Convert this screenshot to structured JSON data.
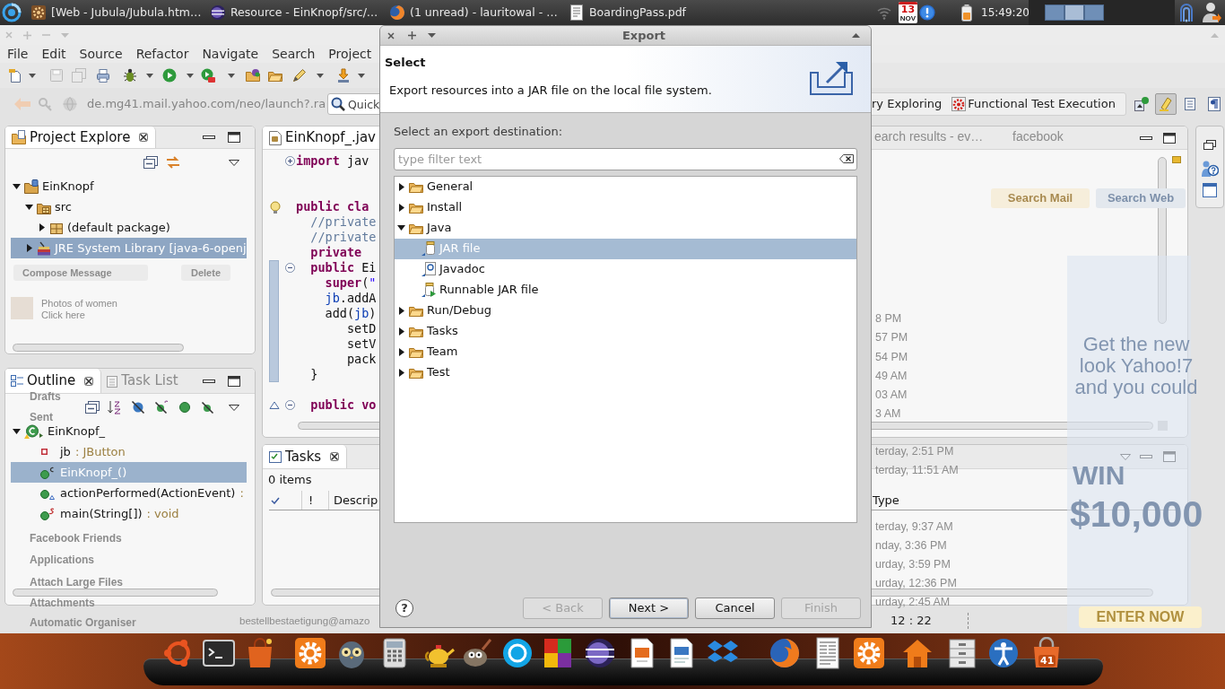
{
  "top_panel": {
    "taskbar": [
      {
        "label": "[Web - Jubula/Jubula.htm…"
      },
      {
        "label": "Resource - EinKnopf/src/…"
      },
      {
        "label": "(1 unread) - lauritowal - …"
      },
      {
        "label": "BoardingPass.pdf"
      }
    ],
    "calendar": {
      "day": "13",
      "month": "NOV"
    },
    "clock": "15:49:20",
    "workspaces": [
      {
        "selected": false
      },
      {
        "selected": true
      },
      {
        "selected": false
      }
    ]
  },
  "eclipse": {
    "menu": [
      "File",
      "Edit",
      "Source",
      "Refactor",
      "Navigate",
      "Search",
      "Project"
    ],
    "quick_access": {
      "placeholder": "Quick"
    },
    "perspectives": [
      {
        "label": "ry Exploring",
        "icon": false
      },
      {
        "label": "Functional Test Execution",
        "icon": true
      }
    ],
    "perspective_tools": [
      {
        "pressed": false
      },
      {
        "pressed": true
      },
      {
        "pressed": false
      },
      {
        "pressed": false
      }
    ],
    "project_explorer": {
      "title": "Project Explore",
      "tree": [
        {
          "kind": "project",
          "label": "EinKnopf",
          "expanded": true,
          "selected": false,
          "children": [
            {
              "kind": "source_folder",
              "label": "src",
              "expanded": true,
              "selected": false,
              "children": [
                {
                  "kind": "package",
                  "label": "(default package)",
                  "expanded": false,
                  "selected": false
                }
              ]
            },
            {
              "kind": "library",
              "label": "JRE System Library [java-6-openj",
              "expanded": false,
              "selected": true
            }
          ]
        }
      ]
    },
    "outline": {
      "tabs": [
        {
          "label": "Outline",
          "selected": true
        },
        {
          "label": "Task List",
          "selected": false
        }
      ],
      "tree": [
        {
          "kind": "class",
          "label": "EinKnopf_",
          "expanded": true,
          "selected": false,
          "children": [
            {
              "kind": "field",
              "label": "jb",
              "detail": ": JButton",
              "selected": false
            },
            {
              "kind": "constructor",
              "label": "EinKnopf_()",
              "selected": true
            },
            {
              "kind": "method",
              "label": "actionPerformed(ActionEvent)",
              "detail": ":",
              "selected": false
            },
            {
              "kind": "static_method",
              "label": "main(String[])",
              "detail": ": void",
              "selected": false
            }
          ]
        }
      ]
    },
    "editor": {
      "tab": "EinKnopf_.jav",
      "lines": [
        {
          "kind": "code",
          "collapsed": true,
          "tokens": [
            {
              "kind": "keyword",
              "text": "import"
            },
            {
              "kind": "plain",
              "text": " jav"
            }
          ]
        },
        {
          "kind": "blank"
        },
        {
          "kind": "blank"
        },
        {
          "kind": "code",
          "annotation": {
            "kind": "warning"
          },
          "tokens": [
            {
              "kind": "keyword",
              "text": "public cla"
            }
          ]
        },
        {
          "kind": "code",
          "tokens": [
            {
              "kind": "comment",
              "text": "  //private"
            }
          ]
        },
        {
          "kind": "code",
          "tokens": [
            {
              "kind": "comment",
              "text": "  //private"
            }
          ]
        },
        {
          "kind": "code",
          "tokens": [
            {
              "kind": "keyword",
              "text": "  private"
            }
          ]
        },
        {
          "kind": "highlighted_range",
          "lines": [
            {
              "kind": "code",
              "collapsed": false,
              "tokens": [
                {
                  "kind": "keyword",
                  "text": "  public"
                },
                {
                  "kind": "plain",
                  "text": " Ei"
                }
              ]
            },
            {
              "kind": "code",
              "tokens": [
                {
                  "kind": "keyword",
                  "text": "    super"
                },
                {
                  "kind": "plain",
                  "text": "("
                },
                {
                  "kind": "string",
                  "text": "\""
                }
              ]
            },
            {
              "kind": "code",
              "tokens": [
                {
                  "kind": "field",
                  "text": "    jb"
                },
                {
                  "kind": "plain",
                  "text": ".addA"
                }
              ]
            },
            {
              "kind": "code",
              "tokens": [
                {
                  "kind": "plain",
                  "text": "    add("
                },
                {
                  "kind": "field",
                  "text": "jb"
                },
                {
                  "kind": "plain",
                  "text": ")"
                }
              ]
            },
            {
              "kind": "code",
              "tokens": [
                {
                  "kind": "plain",
                  "text": "       setD"
                }
              ]
            },
            {
              "kind": "code",
              "tokens": [
                {
                  "kind": "plain",
                  "text": "       setV"
                }
              ]
            },
            {
              "kind": "code",
              "tokens": [
                {
                  "kind": "plain",
                  "text": "       pack"
                }
              ]
            },
            {
              "kind": "code",
              "tokens": [
                {
                  "kind": "plain",
                  "text": "  }"
                }
              ]
            }
          ]
        },
        {
          "kind": "blank"
        },
        {
          "kind": "code",
          "collapsed": false,
          "annotation": {
            "kind": "override"
          },
          "tokens": [
            {
              "kind": "keyword",
              "text": "  public vo"
            }
          ]
        }
      ]
    },
    "tasks": {
      "title": "Tasks",
      "count": "0 items",
      "columns": [
        "!",
        "Descrip",
        "Type"
      ]
    },
    "status": "12 : 22"
  },
  "background_page": {
    "address": "de.mg41.mail.yahoo.com/neo/launch?.ra",
    "tabs": [
      "earch results - ev…",
      "facebook"
    ],
    "compose_button": "Compose Message",
    "delete_button": "Delete",
    "promo": "Photos of women",
    "promo_link": "Click here",
    "search_buttons": [
      "Search Mail",
      "Search Web"
    ],
    "folders": [
      "Drafts",
      "Sent",
      "Facebook Friends",
      "Applications",
      "Attach Large Files",
      "Attachments",
      "Automatic Organiser"
    ],
    "message_times": [
      "8 PM",
      "57 PM",
      "54 PM",
      "49 AM",
      "03 AM",
      "3 AM",
      "terday, 2:51 PM",
      "terday, 11:51 AM",
      "terday, 9:37 AM",
      "nday, 3:36 PM",
      "urday, 3:59 PM",
      "urday, 12:36 PM",
      "urday, 2:45 AM"
    ],
    "last_sender": "bestellbestaetigung@amazo",
    "ad": {
      "headline": "Get the new look Yahoo!7 and you could",
      "prize": "WIN",
      "amount": "$10,000",
      "button": "ENTER NOW"
    }
  },
  "dialog": {
    "title": "Export",
    "heading": "Select",
    "description": "Export resources into a JAR file on the local file system.",
    "label": "Select an export destination:",
    "filter": {
      "placeholder": "type filter text"
    },
    "tree": [
      {
        "label": "General",
        "expanded": false,
        "selected": false
      },
      {
        "label": "Install",
        "expanded": false,
        "selected": false
      },
      {
        "label": "Java",
        "expanded": true,
        "selected": false,
        "children": [
          {
            "kind": "jar",
            "label": "JAR file",
            "selected": true
          },
          {
            "kind": "javadoc",
            "label": "Javadoc",
            "selected": false
          },
          {
            "kind": "runnable_jar",
            "label": "Runnable JAR file",
            "selected": false
          }
        ]
      },
      {
        "label": "Run/Debug",
        "expanded": false,
        "selected": false
      },
      {
        "label": "Tasks",
        "expanded": false,
        "selected": false
      },
      {
        "label": "Team",
        "expanded": false,
        "selected": false
      },
      {
        "label": "Test",
        "expanded": false,
        "selected": false
      }
    ],
    "help": "?",
    "buttons": [
      {
        "label": "< Back",
        "disabled": true,
        "default": false
      },
      {
        "label": "Next >",
        "disabled": false,
        "default": true
      },
      {
        "label": "Cancel",
        "disabled": false,
        "default": false
      },
      {
        "label": "Finish",
        "disabled": true,
        "default": false
      }
    ]
  },
  "dock": {
    "badge": "41"
  }
}
